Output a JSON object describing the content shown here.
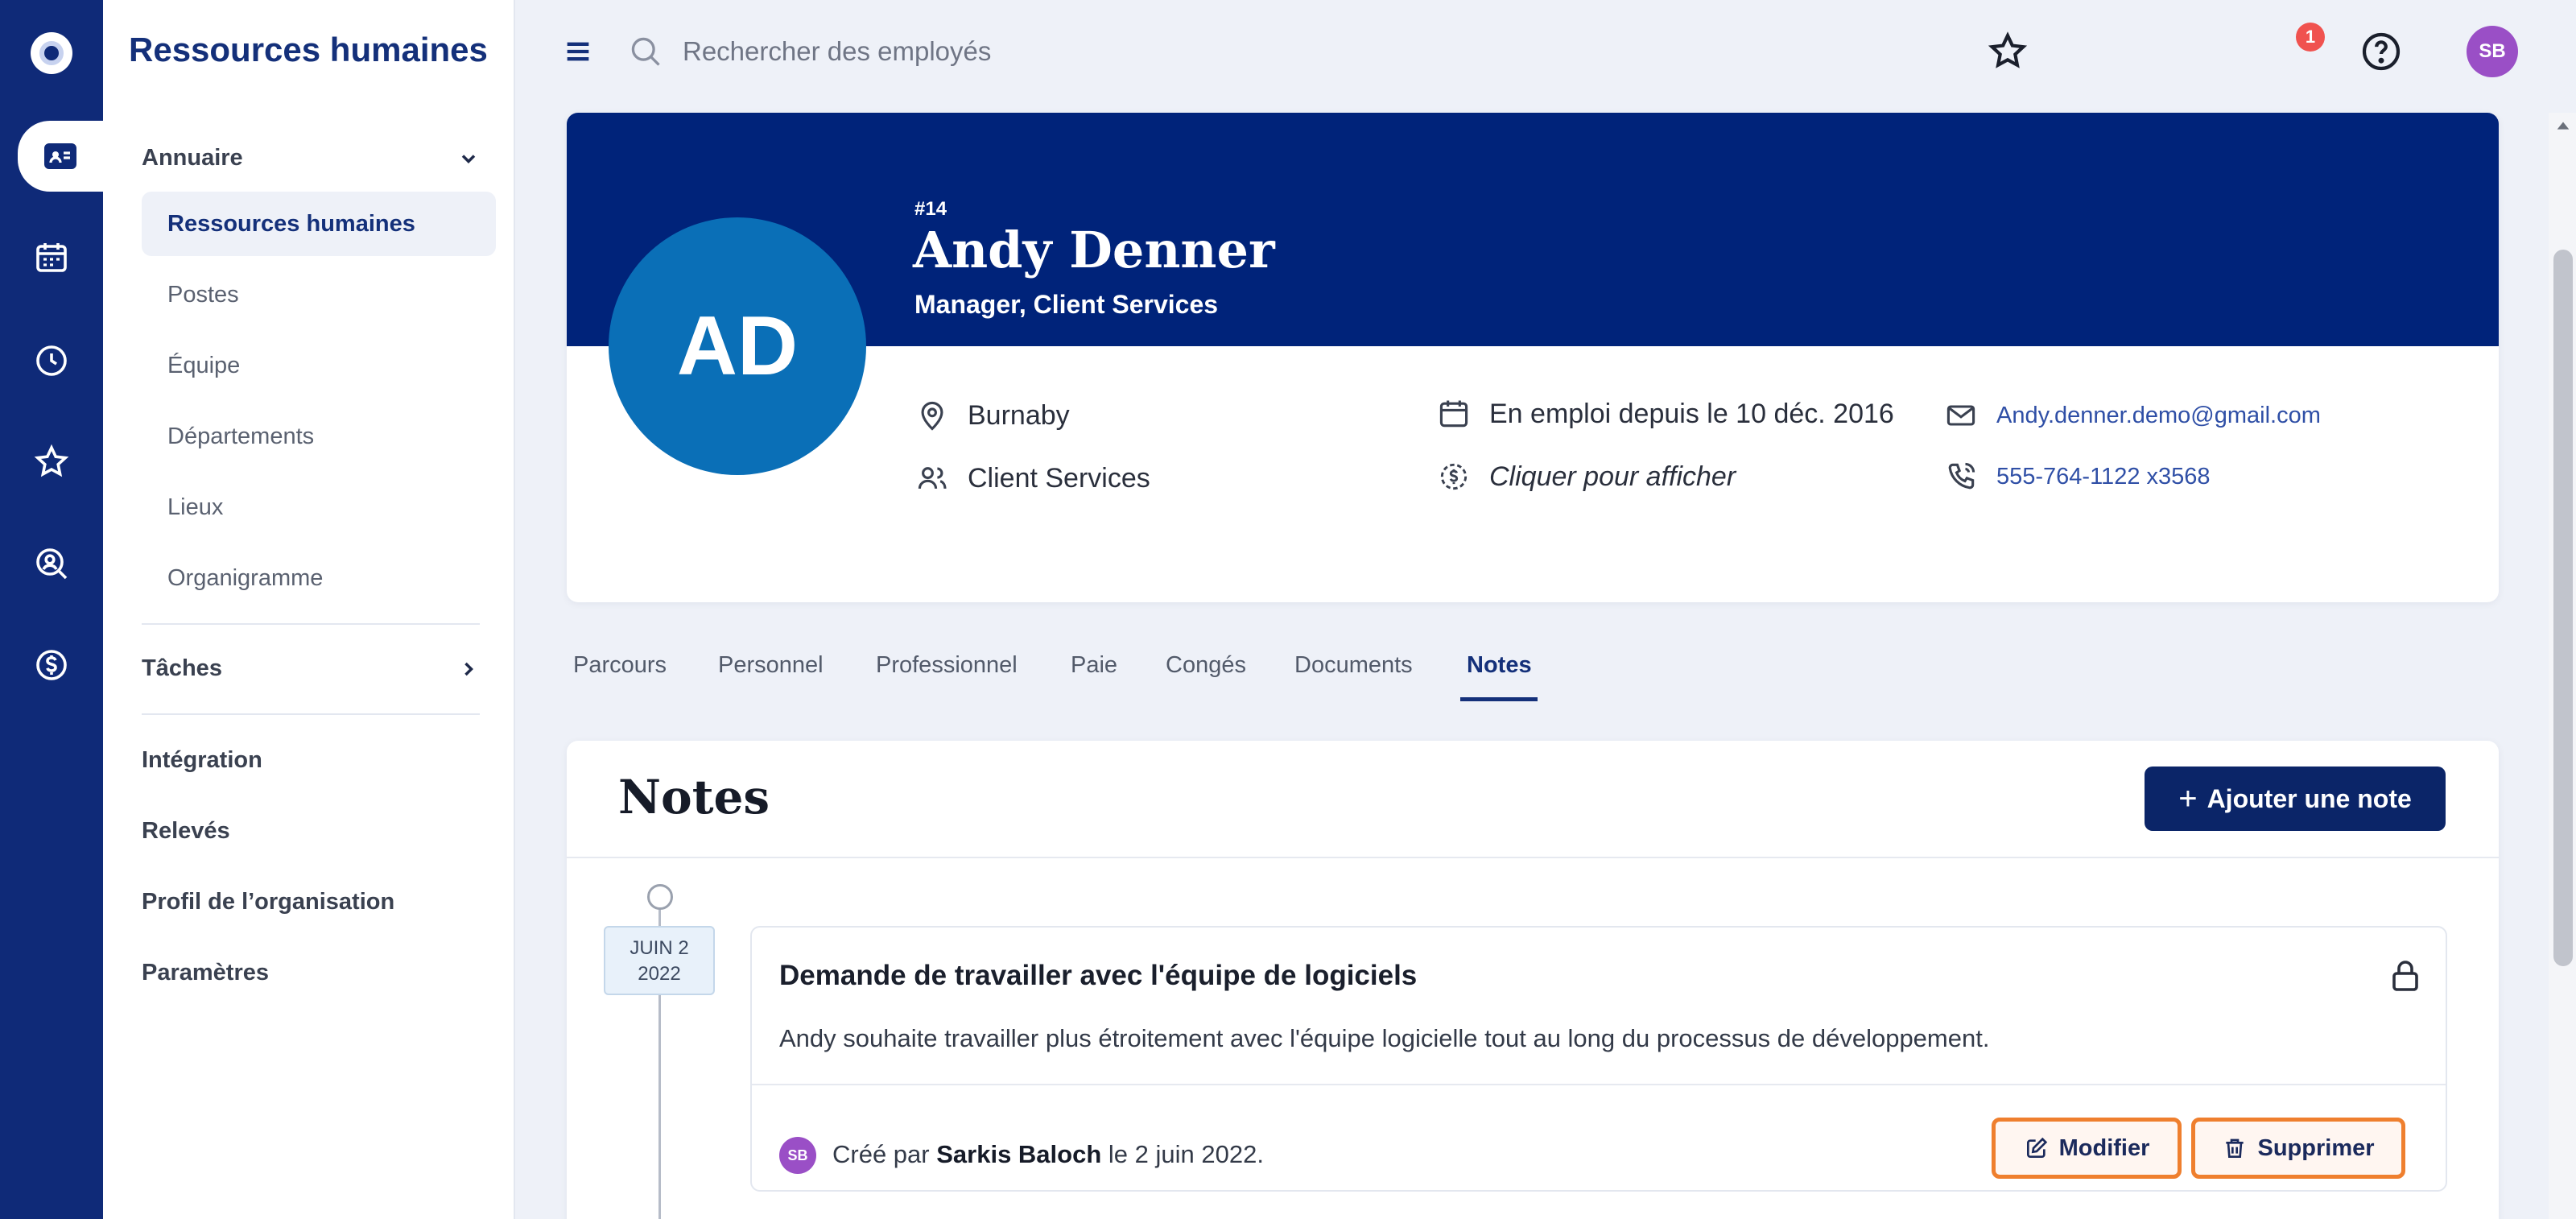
{
  "colors": {
    "rail": "#0f2a78",
    "banner": "#00237a",
    "avatar_big": "#0a6fb7",
    "primary_button": "#0b2568",
    "badge": "#f0524f",
    "user_avatar": "#9a4fc6",
    "highlight_outline": "#ef7f2e"
  },
  "rail": {
    "items": [
      {
        "icon": "logo-icon"
      },
      {
        "icon": "id-card-icon",
        "active": true
      },
      {
        "icon": "calendar-icon"
      },
      {
        "icon": "clock-icon"
      },
      {
        "icon": "star-icon"
      },
      {
        "icon": "search-user-icon"
      },
      {
        "icon": "dollar-icon"
      }
    ]
  },
  "sidebar": {
    "title": "Ressources humaines",
    "sections": [
      {
        "label": "Annuaire",
        "expanded": true,
        "items": [
          "Ressources humaines",
          "Postes",
          "Équipe",
          "Départements",
          "Lieux",
          "Organigramme"
        ],
        "active_item": "Ressources humaines"
      },
      {
        "label": "Tâches",
        "expanded": false
      }
    ],
    "links": [
      "Intégration",
      "Relevés",
      "Profil de l’organisation",
      "Paramètres"
    ]
  },
  "topbar": {
    "search_placeholder": "Rechercher des employés",
    "notification_count": "1",
    "user_initials": "SB"
  },
  "profile": {
    "id": "#14",
    "name": "Andy Denner",
    "title": "Manager, Client Services",
    "initials": "AD",
    "location": "Burnaby",
    "department": "Client Services",
    "employed_since": "En emploi depuis le 10 déc. 2016",
    "salary_hint": "Cliquer pour afficher",
    "email": "Andy.denner.demo@gmail.com",
    "phone": "555-764-1122 x3568"
  },
  "tabs": {
    "items": [
      "Parcours",
      "Personnel",
      "Professionnel",
      "Paie",
      "Congés",
      "Documents",
      "Notes"
    ],
    "active": "Notes"
  },
  "notes": {
    "heading": "Notes",
    "add_button": "Ajouter une note",
    "entries": [
      {
        "date_month_day": "JUIN 2",
        "date_year": "2022",
        "title": "Demande de travailler avec l'équipe de logiciels",
        "body": "Andy souhaite travailler plus étroitement avec l'équipe logicielle tout au long du processus de développement.",
        "author_initials": "SB",
        "created_prefix": "Créé par",
        "author": "Sarkis Baloch",
        "created_suffix": "le 2 juin 2022.",
        "edit_label": "Modifier",
        "delete_label": "Supprimer"
      }
    ]
  }
}
